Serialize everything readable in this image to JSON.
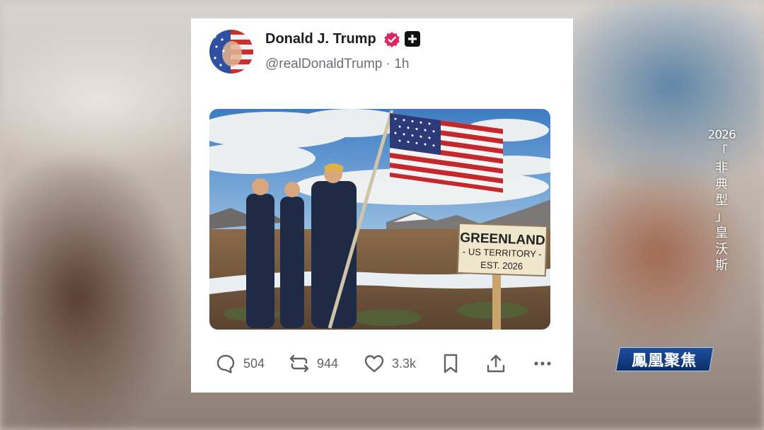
{
  "post": {
    "display_name": "Donald J. Trump",
    "handle": "@realDonaldTrump · 1h",
    "verified_color": "#e0245e",
    "image": {
      "sign_title": "GREENLAND",
      "sign_line1": "- US TERRITORY -",
      "sign_line2": "EST. 2026"
    },
    "actions": {
      "replies": "504",
      "reposts": "944",
      "likes": "3.3k"
    }
  },
  "overlay": {
    "caption_year": "2026",
    "caption_chars": [
      "「",
      "非",
      "典",
      "型",
      "」",
      "皇",
      "沃",
      "斯"
    ],
    "logo_text": "鳳凰聚焦"
  },
  "colors": {
    "logo_blue": "#1d4f9c",
    "card_bg": "#ffffff"
  },
  "icons": [
    "reply-icon",
    "repost-icon",
    "like-icon",
    "bookmark-icon",
    "share-icon",
    "more-icon",
    "verified-icon",
    "plus-badge-icon"
  ]
}
